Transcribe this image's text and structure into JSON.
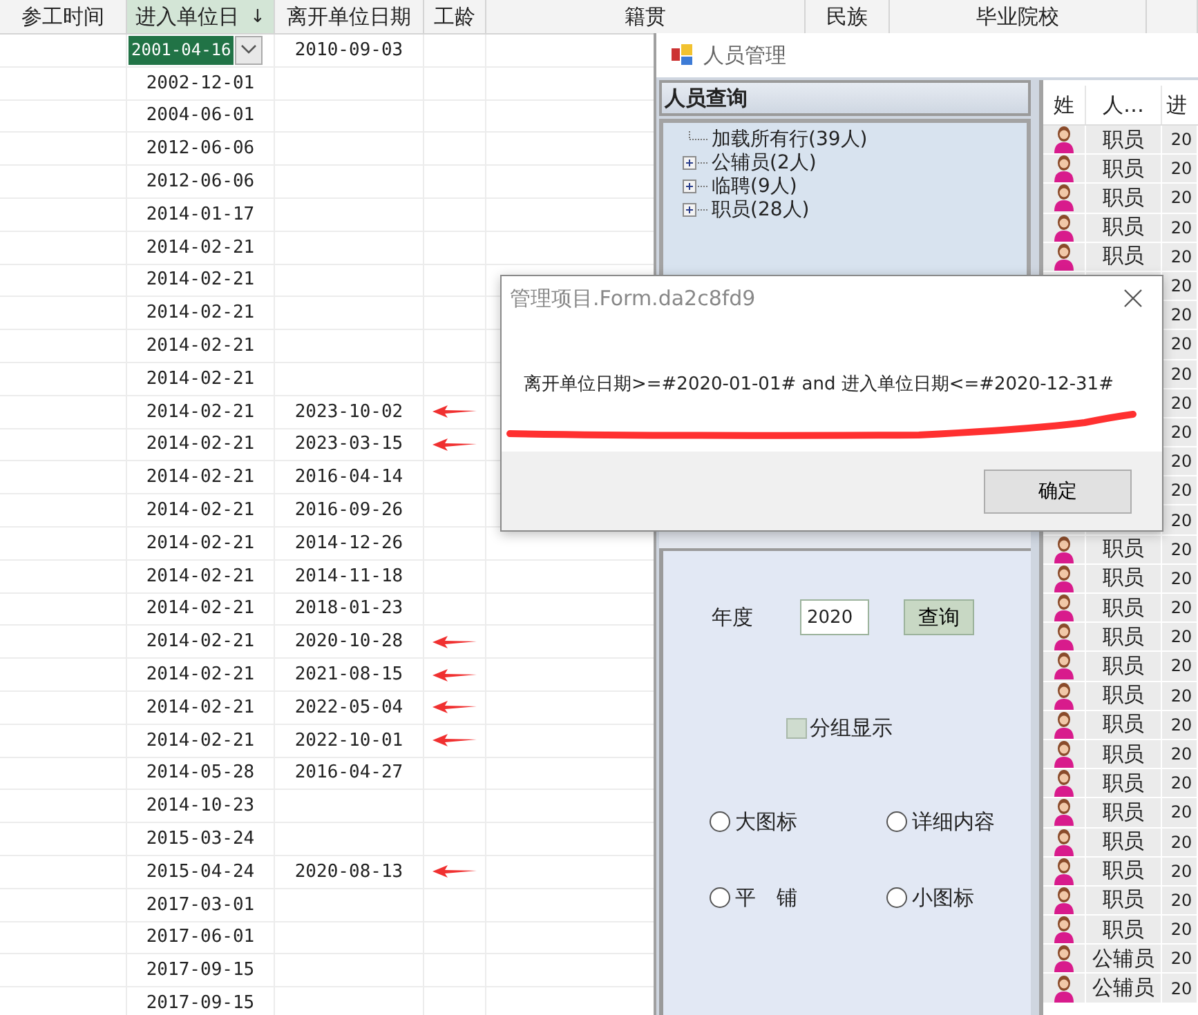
{
  "sheet": {
    "columns": [
      {
        "label": "参工时间",
        "selected": false
      },
      {
        "label": "进入单位日",
        "selected": true,
        "sort_indicator": "↓"
      },
      {
        "label": "离开单位日期",
        "selected": false
      },
      {
        "label": "工龄",
        "selected": false
      },
      {
        "label": "籍贯",
        "selected": false
      },
      {
        "label": "民族",
        "selected": false
      },
      {
        "label": "毕业院校",
        "selected": false
      }
    ],
    "rows": [
      {
        "entry": "2001-04-16",
        "leave": "2010-09-03",
        "selected": true,
        "marked": false
      },
      {
        "entry": "2002-12-01",
        "selected": false,
        "marked": false
      },
      {
        "entry": "2004-06-01",
        "selected": false,
        "marked": false
      },
      {
        "entry": "2012-06-06",
        "selected": false,
        "marked": false
      },
      {
        "entry": "2012-06-06",
        "selected": false,
        "marked": false
      },
      {
        "entry": "2014-01-17",
        "selected": false,
        "marked": false
      },
      {
        "entry": "2014-02-21",
        "selected": false,
        "marked": false
      },
      {
        "entry": "2014-02-21",
        "selected": false,
        "marked": false
      },
      {
        "entry": "2014-02-21",
        "selected": false,
        "marked": false
      },
      {
        "entry": "2014-02-21",
        "selected": false,
        "marked": false
      },
      {
        "entry": "2014-02-21",
        "selected": false,
        "marked": false
      },
      {
        "entry": "2014-02-21",
        "leave": "2023-10-02",
        "selected": false,
        "marked": true
      },
      {
        "entry": "2014-02-21",
        "leave": "2023-03-15",
        "selected": false,
        "marked": true
      },
      {
        "entry": "2014-02-21",
        "leave": "2016-04-14",
        "selected": false,
        "marked": false
      },
      {
        "entry": "2014-02-21",
        "leave": "2016-09-26",
        "selected": false,
        "marked": false
      },
      {
        "entry": "2014-02-21",
        "leave": "2014-12-26",
        "selected": false,
        "marked": false
      },
      {
        "entry": "2014-02-21",
        "leave": "2014-11-18",
        "selected": false,
        "marked": false
      },
      {
        "entry": "2014-02-21",
        "leave": "2018-01-23",
        "selected": false,
        "marked": false
      },
      {
        "entry": "2014-02-21",
        "leave": "2020-10-28",
        "selected": false,
        "marked": true
      },
      {
        "entry": "2014-02-21",
        "leave": "2021-08-15",
        "selected": false,
        "marked": true
      },
      {
        "entry": "2014-02-21",
        "leave": "2022-05-04",
        "selected": false,
        "marked": true
      },
      {
        "entry": "2014-02-21",
        "leave": "2022-10-01",
        "selected": false,
        "marked": true
      },
      {
        "entry": "2014-05-28",
        "leave": "2016-04-27",
        "selected": false,
        "marked": false
      },
      {
        "entry": "2014-10-23",
        "selected": false,
        "marked": false
      },
      {
        "entry": "2015-03-24",
        "selected": false,
        "marked": false
      },
      {
        "entry": "2015-04-24",
        "leave": "2020-08-13",
        "selected": false,
        "marked": true
      },
      {
        "entry": "2017-03-01",
        "selected": false,
        "marked": false
      },
      {
        "entry": "2017-06-01",
        "selected": false,
        "marked": false
      },
      {
        "entry": "2017-09-15",
        "selected": false,
        "marked": false
      },
      {
        "entry": "2017-09-15",
        "selected": false,
        "marked": false
      }
    ]
  },
  "window": {
    "title": "人员管理",
    "query_panel": {
      "title": "人员查询",
      "tree": [
        {
          "label": "加载所有行(39人)",
          "kind": "leaf"
        },
        {
          "label": "公辅员(2人)",
          "kind": "group",
          "expanded": false
        },
        {
          "label": "临聘(9人)",
          "kind": "group",
          "expanded": false
        },
        {
          "label": "职员(28人)",
          "kind": "group",
          "expanded": false
        }
      ]
    },
    "options": {
      "year_label": "年度",
      "year_value": "2020",
      "query_button": "查询",
      "group_checkbox": {
        "label": "分组显示",
        "checked": false
      },
      "view_modes": [
        {
          "label": "大图标",
          "selected": false
        },
        {
          "label": "详细内容",
          "selected": false
        },
        {
          "label": "平　铺",
          "selected": false
        },
        {
          "label": "小图标",
          "selected": false
        }
      ]
    },
    "list": {
      "columns": [
        "姓",
        "人…",
        "进"
      ],
      "rows": [
        {
          "type": "职员",
          "column_3": "20"
        },
        {
          "type": "职员",
          "column_3": "20"
        },
        {
          "type": "职员",
          "column_3": "20"
        },
        {
          "type": "职员",
          "column_3": "20"
        },
        {
          "type": "职员",
          "column_3": "20"
        },
        {
          "column_3": "20"
        },
        {
          "column_3": "20"
        },
        {
          "column_3": "20"
        },
        {
          "column_3": "20"
        },
        {
          "column_3": "20"
        },
        {
          "column_3": "20"
        },
        {
          "column_3": "20"
        },
        {
          "column_3": "20"
        },
        {
          "column_3": "20"
        },
        {
          "type": "职员",
          "column_3": "20"
        },
        {
          "type": "职员",
          "column_3": "20"
        },
        {
          "type": "职员",
          "column_3": "20"
        },
        {
          "type": "职员",
          "column_3": "20"
        },
        {
          "type": "职员",
          "column_3": "20"
        },
        {
          "type": "职员",
          "column_3": "20"
        },
        {
          "type": "职员",
          "column_3": "20"
        },
        {
          "type": "职员",
          "column_3": "20"
        },
        {
          "type": "职员",
          "column_3": "20"
        },
        {
          "type": "职员",
          "column_3": "20"
        },
        {
          "type": "职员",
          "column_3": "20"
        },
        {
          "type": "职员",
          "column_3": "20"
        },
        {
          "type": "职员",
          "column_3": "20"
        },
        {
          "type": "职员",
          "column_3": "20"
        },
        {
          "type": "公辅员",
          "column_3": "20"
        },
        {
          "type": "公辅员",
          "column_3": "20"
        }
      ]
    }
  },
  "dialog": {
    "title": "管理项目.Form.da2c8fd9",
    "message": "离开单位日期>=#2020-01-01# and 进入单位日期<=#2020-12-31#",
    "underlined": true,
    "ok_button": "确定"
  }
}
